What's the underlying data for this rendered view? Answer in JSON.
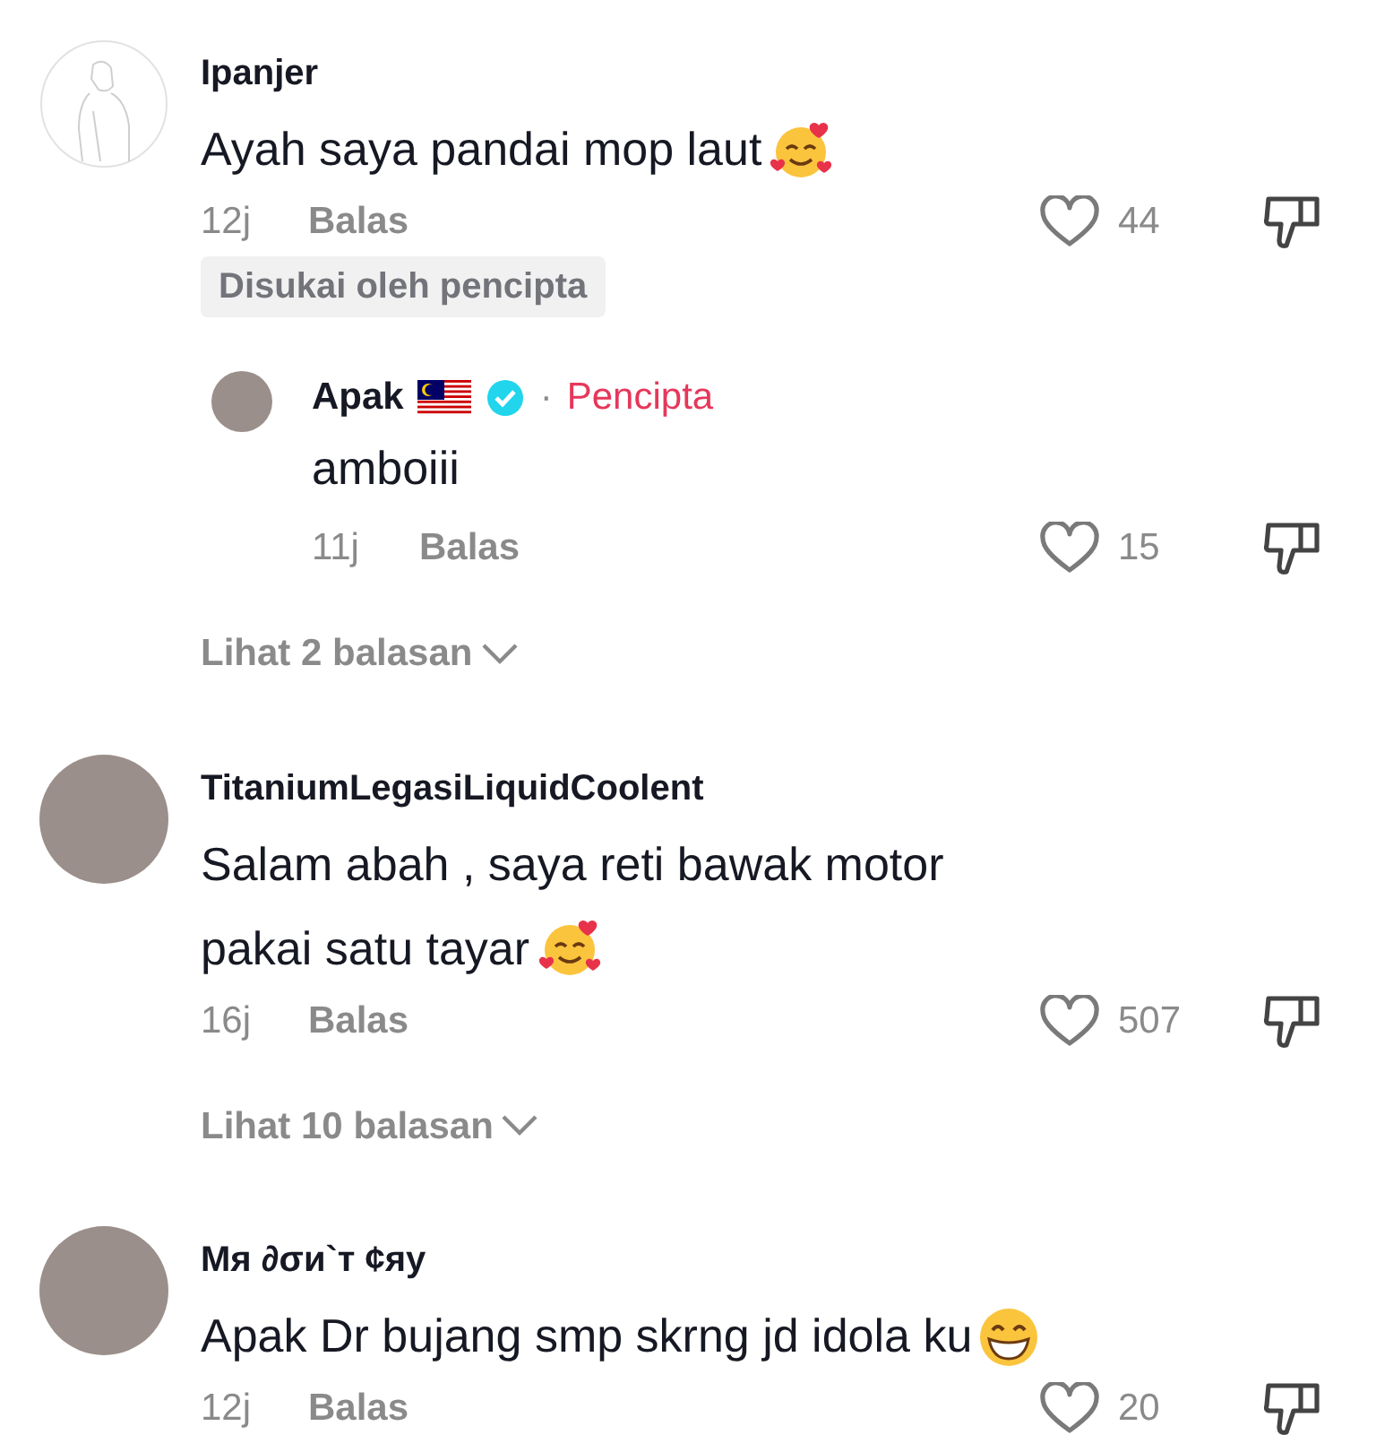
{
  "comments": [
    {
      "avatar": {
        "kind": "sketch"
      },
      "name": "Ipanjer",
      "lines": [
        "Ayah saya pandai mop laut"
      ],
      "emoji": {
        "kind": "hearts"
      },
      "time": "12j",
      "reply": "Balas",
      "likes": "44",
      "badge": "Disukai oleh pencipta",
      "replies": [
        {
          "avatar": {
            "kind": "photo"
          },
          "name": "Apak",
          "flag": true,
          "verified": true,
          "separator": "·",
          "role": "Pencipta",
          "lines": [
            "amboiii"
          ],
          "time": "11j",
          "reply": "Balas",
          "likes": "15"
        }
      ],
      "more": "Lihat 2 balasan"
    },
    {
      "avatar": {
        "kind": "photo"
      },
      "name": "TitaniumLegasiLiquidCoolent",
      "lines": [
        "Salam abah , saya reti bawak motor",
        "pakai satu tayar"
      ],
      "emoji": {
        "kind": "hearts"
      },
      "time": "16j",
      "reply": "Balas",
      "likes": "507",
      "more": "Lihat 10 balasan"
    },
    {
      "avatar": {
        "kind": "photo"
      },
      "name": "Mя ∂σи`т ¢яу",
      "lines": [
        "Apak Dr bujang smp skrng jd idola ku"
      ],
      "emoji": {
        "kind": "grin"
      },
      "time": "12j",
      "reply": "Balas",
      "likes": "20"
    }
  ]
}
